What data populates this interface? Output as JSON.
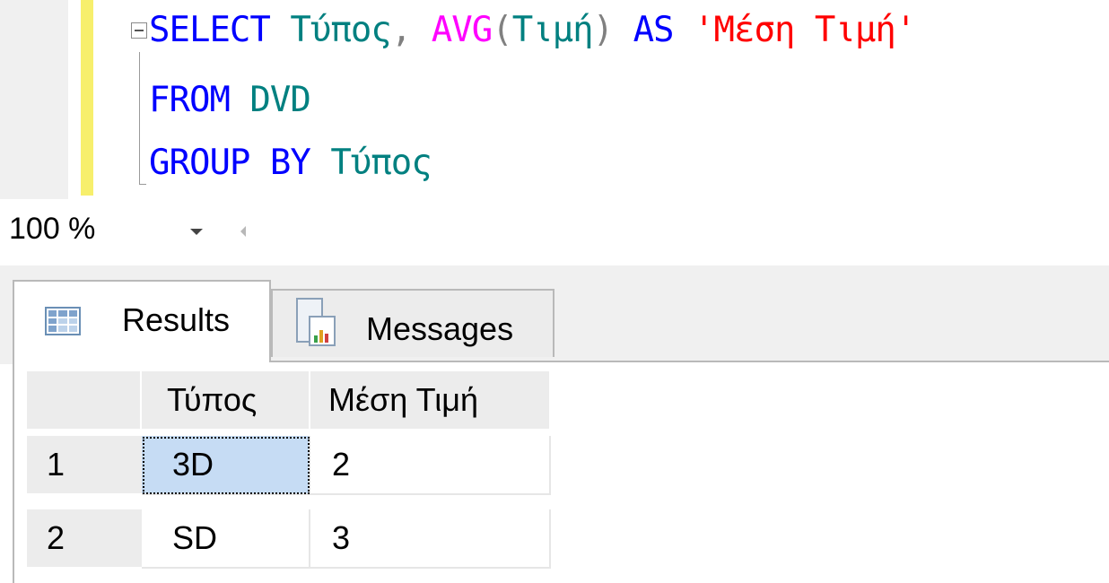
{
  "editor": {
    "line1": {
      "kw_select": "SELECT",
      "col_type": "Τύπος",
      "comma": ",",
      "fn_avg": "AVG",
      "paren_open": "(",
      "col_price": "Τιμή",
      "paren_close": ")",
      "kw_as": "AS",
      "alias": "'Μέση Τιμή'"
    },
    "line2": {
      "kw_from": "FROM",
      "table": "DVD"
    },
    "line3": {
      "kw_group_by": "GROUP BY",
      "col_type": "Τύπος"
    }
  },
  "zoom": {
    "value": "100 %"
  },
  "tabs": [
    {
      "label": "Results",
      "icon": "grid-icon",
      "active": true
    },
    {
      "label": "Messages",
      "icon": "messages-icon",
      "active": false
    }
  ],
  "results": {
    "columns": [
      "Τύπος",
      "Μέση Τιμή"
    ],
    "rows": [
      {
        "num": "1",
        "cells": [
          "3D",
          "2"
        ]
      },
      {
        "num": "2",
        "cells": [
          "SD",
          "3"
        ]
      }
    ]
  },
  "colors": {
    "keyword": "#0000ff",
    "function": "#ff00ff",
    "identifier": "#008080",
    "string": "#ff0000",
    "selected_cell": "#c6dcf4",
    "change_bar": "#f7ef6c"
  }
}
